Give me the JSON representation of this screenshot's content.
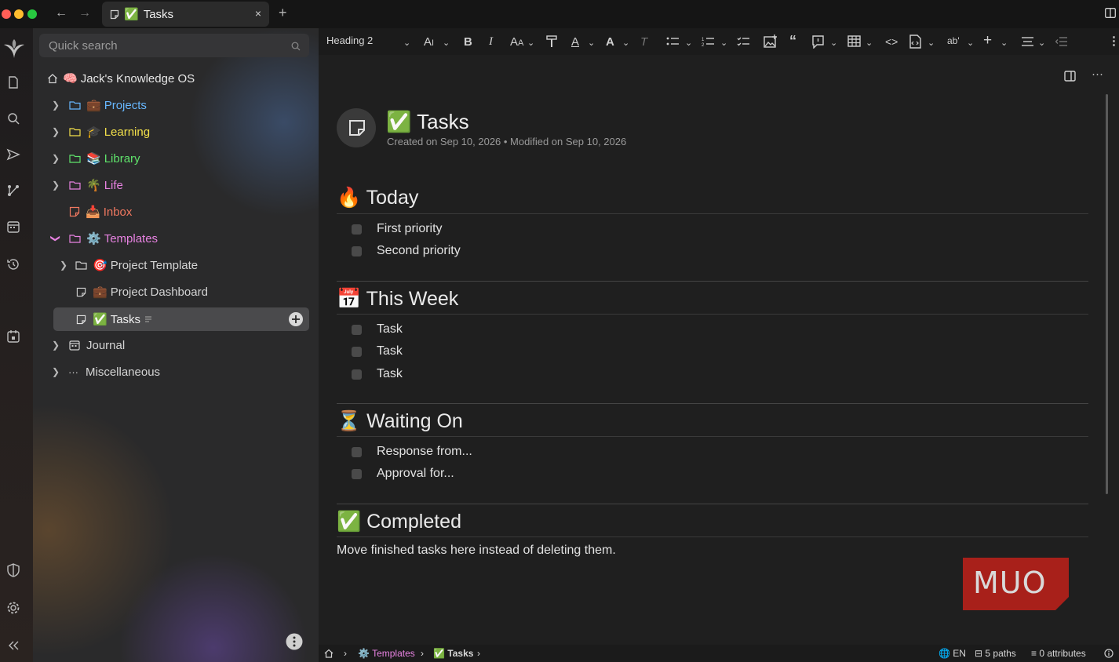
{
  "tab": {
    "emoji": "✅",
    "title": "Tasks",
    "close": "×",
    "new": "+"
  },
  "nav": {
    "back": "←",
    "forward": "→"
  },
  "sidebar": {
    "search_placeholder": "Quick search",
    "root": {
      "emoji": "🧠",
      "label": "Jack's Knowledge OS"
    },
    "items": [
      {
        "emoji": "💼",
        "label": "Projects",
        "color": "#67b7ff"
      },
      {
        "emoji": "🎓",
        "label": "Learning",
        "color": "#f3e04a"
      },
      {
        "emoji": "📚",
        "label": "Library",
        "color": "#5fe36b"
      },
      {
        "emoji": "🌴",
        "label": "Life",
        "color": "#e782e1"
      },
      {
        "emoji": "📥",
        "label": "Inbox",
        "color": "#f07860"
      },
      {
        "emoji": "⚙️",
        "label": "Templates",
        "color": "#e782e1"
      },
      {
        "emoji": "🎯",
        "label": "Project Template",
        "color": "#d4d4d4"
      },
      {
        "emoji": "💼",
        "label": "Project Dashboard",
        "color": "#d4d4d4"
      },
      {
        "emoji": "✅",
        "label": "Tasks",
        "color": "#f0f0f0"
      },
      {
        "emoji": "📅",
        "label": "Journal",
        "color": "#d4d4d4"
      },
      {
        "emoji": "···",
        "label": "Miscellaneous",
        "color": "#d4d4d4"
      }
    ]
  },
  "toolbar": {
    "heading": "Heading 2"
  },
  "note": {
    "emoji": "✅",
    "title": "Tasks",
    "meta": "Created on Sep 10, 2026 • Modified on Sep 10, 2026",
    "sections": [
      {
        "emoji": "🔥",
        "heading": "Today",
        "items": [
          "First priority",
          "Second priority"
        ]
      },
      {
        "emoji": "📅",
        "heading": "This Week",
        "items": [
          "Task",
          "Task",
          "Task"
        ]
      },
      {
        "emoji": "⏳",
        "heading": "Waiting On",
        "items": [
          "Response from...",
          "Approval for..."
        ]
      },
      {
        "emoji": "✅",
        "heading": "Completed",
        "items": []
      }
    ],
    "completed_text": "Move finished tasks here instead of deleting them."
  },
  "logo": {
    "text": "MUO"
  },
  "statusbar": {
    "crumb1": "Templates",
    "crumb2": "Tasks",
    "lang": "EN",
    "paths": "5 paths",
    "attributes": "0 attributes"
  }
}
